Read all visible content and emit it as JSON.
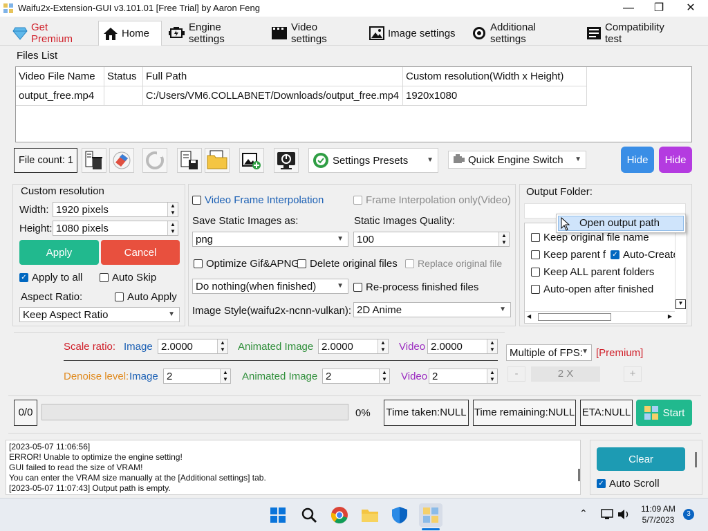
{
  "window": {
    "title": "Waifu2x-Extension-GUI v3.101.01 [Free Trial] by Aaron Feng",
    "minimize": "—",
    "maximize": "❐",
    "close": "✕"
  },
  "tabs": [
    {
      "label": "Get Premium",
      "icon": "diamond-icon"
    },
    {
      "label": "Home",
      "icon": "home-icon"
    },
    {
      "label": "Engine settings",
      "icon": "engine-icon"
    },
    {
      "label": "Video settings",
      "icon": "film-icon"
    },
    {
      "label": "Image settings",
      "icon": "image-icon"
    },
    {
      "label": "Additional settings",
      "icon": "gear-icon"
    },
    {
      "label": "Compatibility test",
      "icon": "checklist-icon"
    }
  ],
  "files": {
    "group_title": "Files List",
    "columns": [
      "Video File Name",
      "Status",
      "Full Path",
      "Custom resolution(Width x Height)"
    ],
    "rows": [
      [
        "output_free.mp4",
        "",
        "C:/Users/VM6.COLLABNET/Downloads/output_free.mp4",
        "1920x1080"
      ]
    ]
  },
  "toolbar": {
    "file_count": "File count: 1",
    "settings_presets": "Settings Presets",
    "quick_engine_switch": "Quick Engine Switch",
    "hide1": "Hide",
    "hide2": "Hide",
    "hide1_color": "#3a8ee6",
    "hide2_color": "#b43be0"
  },
  "custom_resolution": {
    "title": "Custom resolution",
    "width_label": "Width:",
    "width_value": "1920 pixels",
    "height_label": "Height:",
    "height_value": "1080 pixels",
    "apply": "Apply",
    "cancel": "Cancel",
    "apply_color": "#21b98e",
    "cancel_color": "#e8503e",
    "apply_to_all": "Apply to all",
    "auto_skip": "Auto Skip",
    "aspect_label": "Aspect Ratio:",
    "auto_apply": "Auto Apply",
    "aspect_value": "Keep Aspect Ratio"
  },
  "middle": {
    "vfi": "Video Frame Interpolation",
    "fi_only": "Frame Interpolation only(Video)",
    "save_static_label": "Save Static Images as:",
    "save_static_value": "png",
    "quality_label": "Static Images Quality:",
    "quality_value": "100",
    "optimize_gif": "Optimize Gif&APNG",
    "delete_original": "Delete original files",
    "replace_original": "Replace original file",
    "when_finished": "Do nothing(when finished)",
    "reprocess": "Re-process finished files",
    "image_style_label": "Image Style(waifu2x-ncnn-vulkan):",
    "image_style_value": "2D Anime"
  },
  "output": {
    "title": "Output Folder:",
    "context_menu_item": "Open output path",
    "keep_original_name": "Keep original file name",
    "keep_parent": "Keep parent f",
    "auto_create": "Auto-Create",
    "keep_all_parents": "Keep ALL parent folders",
    "auto_open": "Auto-open after finished"
  },
  "scale": {
    "scale_label": "Scale ratio:",
    "image_label": "Image",
    "image_value": "2.0000",
    "anim_label": "Animated Image",
    "anim_value": "2.0000",
    "video_label": "Video",
    "video_value": "2.0000",
    "fps_value": "Multiple of FPS:",
    "premium": "[Premium]",
    "minus": "-",
    "fps_mult": "2 X",
    "plus": "+",
    "denoise_label": "Denoise level:",
    "dn_image_label": "Image",
    "dn_image_value": "2",
    "dn_anim_label": "Animated Image",
    "dn_anim_value": "2",
    "dn_video_label": "Video",
    "dn_video_value": "2"
  },
  "progress": {
    "count": "0/0",
    "percent": "0%",
    "fraction": 0,
    "time_taken": "Time taken:NULL",
    "time_remaining": "Time remaining:NULL",
    "eta": "ETA:NULL",
    "start": "Start",
    "start_color": "#21b98e"
  },
  "log": {
    "lines": [
      "[2023-05-07 11:06:56]",
      "ERROR! Unable to optimize the engine setting!",
      "GUI failed to read the size of VRAM!",
      "You can enter the VRAM size manually at the [Additional settings] tab.",
      "[2023-05-07 11:07:43] Output path is empty."
    ],
    "clear": "Clear",
    "clear_color": "#1d9bb3",
    "auto_scroll": "Auto Scroll"
  },
  "taskbar": {
    "time": "11:09 AM",
    "date": "5/7/2023",
    "badge": "3"
  }
}
